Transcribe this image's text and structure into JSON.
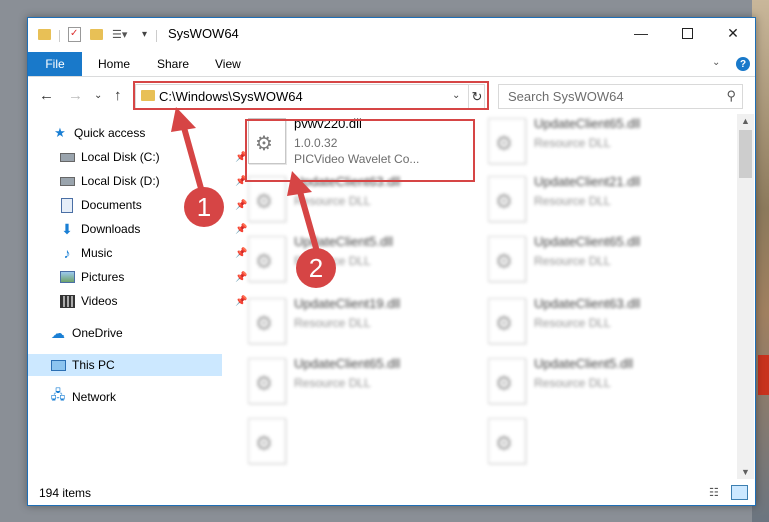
{
  "window": {
    "title": "SysWOW64",
    "minimize_icon": "minimize-icon",
    "maximize_icon": "maximize-icon",
    "close_icon": "close-icon"
  },
  "ribbon": {
    "tabs": [
      "File",
      "Home",
      "Share",
      "View"
    ],
    "accent": "#1979ca",
    "help": "?"
  },
  "address": {
    "path": "C:\\Windows\\SysWOW64",
    "search_placeholder": "Search SysWOW64"
  },
  "nav": {
    "quick_access": "Quick access",
    "items": [
      {
        "label": "Local Disk (C:)",
        "icon": "drive-icon",
        "pinned": true
      },
      {
        "label": "Local Disk (D:)",
        "icon": "drive-icon",
        "pinned": true
      },
      {
        "label": "Documents",
        "icon": "documents-icon",
        "pinned": true
      },
      {
        "label": "Downloads",
        "icon": "downloads-icon",
        "pinned": true
      },
      {
        "label": "Music",
        "icon": "music-icon",
        "pinned": true
      },
      {
        "label": "Pictures",
        "icon": "pictures-icon",
        "pinned": true
      },
      {
        "label": "Videos",
        "icon": "videos-icon",
        "pinned": true
      }
    ],
    "onedrive": "OneDrive",
    "this_pc": "This PC",
    "network": "Network"
  },
  "files": [
    {
      "name": "pvwv220.dll",
      "line2": "1.0.0.32",
      "line3": "PICVideo Wavelet Co...",
      "highlight": true
    },
    {
      "name": "UpdateClient65.dll",
      "line2": "Resource DLL"
    },
    {
      "name": "UpdateClient63.dll",
      "line2": "Resource DLL"
    },
    {
      "name": "UpdateClient21.dll",
      "line2": "Resource DLL"
    },
    {
      "name": "UpdateClient5.dll",
      "line2": "Resource DLL"
    },
    {
      "name": "UpdateClient65.dll",
      "line2": "Resource DLL"
    },
    {
      "name": "UpdateClient19.dll",
      "line2": "Resource DLL"
    },
    {
      "name": "UpdateClient63.dll",
      "line2": "Resource DLL"
    },
    {
      "name": "UpdateClient65.dll",
      "line2": "Resource DLL"
    },
    {
      "name": "UpdateClient5.dll",
      "line2": "Resource DLL"
    }
  ],
  "status": {
    "items": "194 items"
  },
  "annotations": {
    "badge1": "1",
    "badge2": "2",
    "color": "#d64545"
  }
}
